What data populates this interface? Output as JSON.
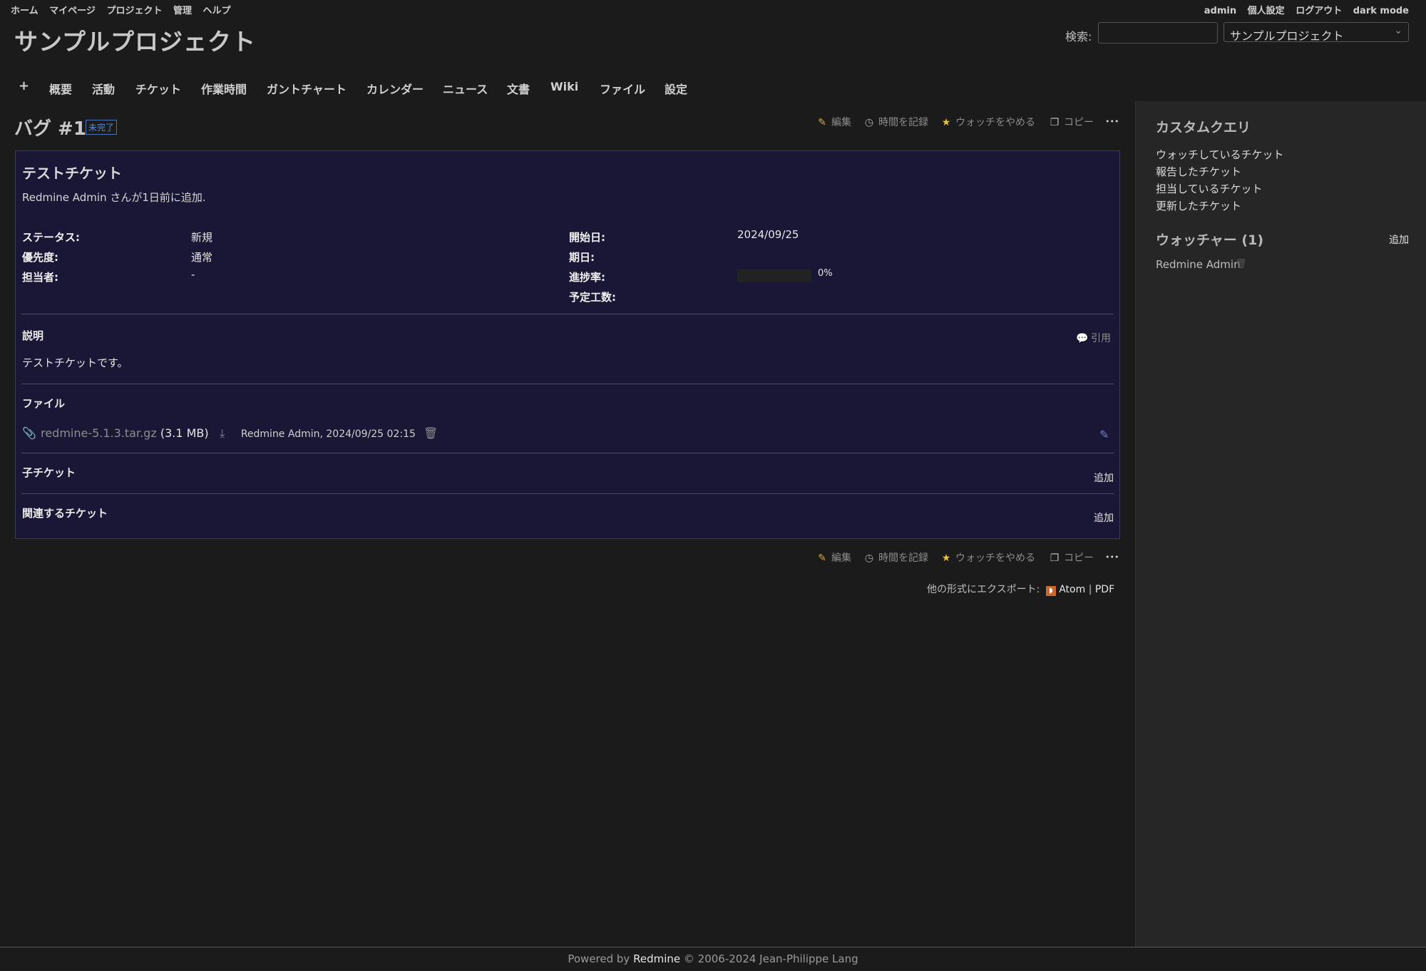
{
  "top_menu": {
    "left": [
      "ホーム",
      "マイページ",
      "プロジェクト",
      "管理",
      "ヘルプ"
    ],
    "right": [
      "admin",
      "個人設定",
      "ログアウト",
      "dark mode"
    ]
  },
  "project_title": "サンプルプロジェクト",
  "search": {
    "label": "検索:",
    "value": "",
    "project_select": "サンプルプロジェクト"
  },
  "main_menu": [
    "+",
    "概要",
    "活動",
    "チケット",
    "作業時間",
    "ガントチャート",
    "カレンダー",
    "ニュース",
    "文書",
    "Wiki",
    "ファイル",
    "設定"
  ],
  "issue": {
    "heading": "バグ #1",
    "status_badge": "未完了",
    "actions": {
      "edit": "編集",
      "log_time": "時間を記録",
      "unwatch": "ウォッチをやめる",
      "copy": "コピー",
      "more": "•••"
    },
    "subject": "テストチケット",
    "author": "Redmine Admin さんが1日前に追加.",
    "attributes": {
      "status_label": "ステータス:",
      "status_value": "新規",
      "priority_label": "優先度:",
      "priority_value": "通常",
      "assignee_label": "担当者:",
      "assignee_value": "-",
      "start_label": "開始日:",
      "start_value": "2024/09/25",
      "due_label": "期日:",
      "due_value": "",
      "progress_label": "進捗率:",
      "progress_value": "0%",
      "progress_fraction": 0,
      "estimated_label": "予定工数:",
      "estimated_value": ""
    },
    "description_label": "説明",
    "quote_label": "引用",
    "description_text": "テストチケットです。",
    "files_label": "ファイル",
    "attachment": {
      "filename": "redmine-5.1.3.tar.gz",
      "size": "(3.1 MB)",
      "meta": "Redmine Admin, 2024/09/25 02:15"
    },
    "subtasks_label": "子チケット",
    "subtasks_add": "追加",
    "relations_label": "関連するチケット",
    "relations_add": "追加"
  },
  "export": {
    "label": "他の形式にエクスポート:",
    "atom": "Atom",
    "separator": "|",
    "pdf": "PDF"
  },
  "sidebar": {
    "custom_queries_title": "カスタムクエリ",
    "queries": [
      "ウォッチしているチケット",
      "報告したチケット",
      "担当しているチケット",
      "更新したチケット"
    ],
    "watchers_title": "ウォッチャー (1)",
    "watchers_add": "追加",
    "watcher_name": "Redmine Admin"
  },
  "footer": {
    "prefix": "Powered by",
    "brand": "Redmine",
    "suffix": "© 2006-2024 Jean-Philippe Lang"
  },
  "colors": {
    "issue_bg": "#1a1635",
    "page_bg": "#1b1b1b",
    "sidebar_bg": "#262626",
    "badge": "#4a72b8"
  }
}
